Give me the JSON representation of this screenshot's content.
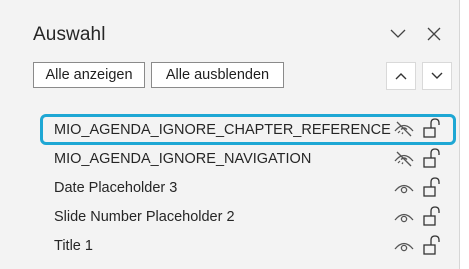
{
  "pane": {
    "title": "Auswahl",
    "buttons": {
      "show_all": "Alle anzeigen",
      "hide_all": "Alle ausblenden"
    },
    "icons": {
      "options": "chevron-down-icon",
      "close": "close-icon",
      "bring_forward": "chevron-up-icon",
      "send_backward": "chevron-down-icon"
    }
  },
  "items": [
    {
      "label": "MIO_AGENDA_IGNORE_CHAPTER_REFERENCE",
      "visible": false,
      "locked": false,
      "selected": true
    },
    {
      "label": "MIO_AGENDA_IGNORE_NAVIGATION",
      "visible": false,
      "locked": false,
      "selected": false
    },
    {
      "label": "Date Placeholder 3",
      "visible": true,
      "locked": false,
      "selected": false
    },
    {
      "label": "Slide Number Placeholder 2",
      "visible": true,
      "locked": false,
      "selected": false
    },
    {
      "label": "Title 1",
      "visible": true,
      "locked": false,
      "selected": false
    }
  ],
  "colors": {
    "selection_border": "#1ea7d4",
    "pane_background": "#f3f3f3"
  }
}
